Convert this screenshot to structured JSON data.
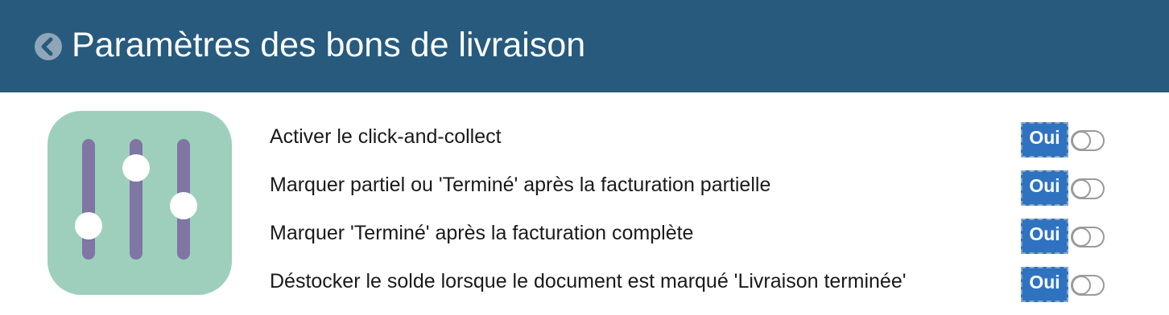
{
  "header": {
    "title": "Paramètres des bons de livraison",
    "background_color": "#275a7d",
    "back_icon": "chevron-left-circle-icon"
  },
  "app_icon": {
    "name": "sliders-icon",
    "background_color": "#9ecfbd",
    "track_color": "#7f76a4"
  },
  "settings": {
    "rows": [
      {
        "label": "Activer le click-and-collect",
        "badge": "Oui",
        "toggle_on": false
      },
      {
        "label": "Marquer partiel ou 'Terminé' après la facturation partielle",
        "badge": "Oui",
        "toggle_on": false
      },
      {
        "label": "Marquer 'Terminé' après la facturation complète",
        "badge": "Oui",
        "toggle_on": false
      },
      {
        "label": "Déstocker le solde lorsque le document est marqué 'Livraison terminée'",
        "badge": "Oui",
        "toggle_on": false
      }
    ],
    "badge_color": "#2f73c0"
  }
}
